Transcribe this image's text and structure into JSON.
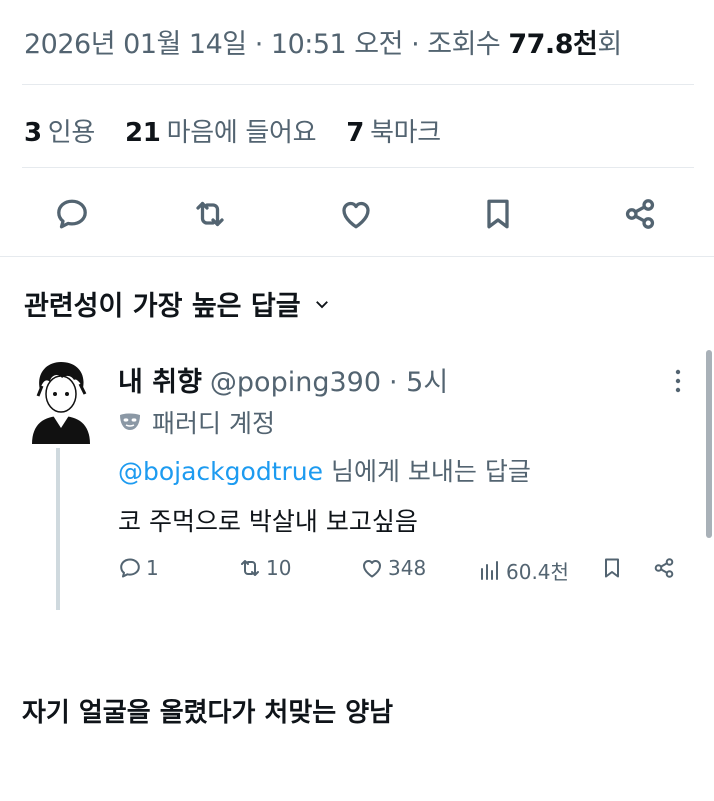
{
  "tweet_meta": {
    "date": "2026년 01월 14일",
    "time": "10:51 오전",
    "views_prefix": "조회수",
    "views_value": "77.8천",
    "views_suffix": "회"
  },
  "stats": {
    "quotes_count": "3",
    "quotes_label": "인용",
    "likes_count": "21",
    "likes_label": "마음에 들어요",
    "bookmarks_count": "7",
    "bookmarks_label": "북마크"
  },
  "action_icons": [
    "reply-icon",
    "retweet-icon",
    "like-icon",
    "bookmark-icon",
    "share-icon"
  ],
  "sort": {
    "label": "관련성이 가장 높은 답글"
  },
  "reply": {
    "name": "내 취향",
    "handle": "@poping390",
    "time": "· 5시",
    "parody_label": "패러디 계정",
    "reply_to_handle": "@bojackgodtrue",
    "reply_to_suffix": " 님에게 보내는 답글",
    "text": "코 주먹으로 박살내 보고싶음",
    "replies": "1",
    "retweets": "10",
    "likes": "348",
    "views": "60.4천"
  },
  "caption": "자기 얼굴을 올렸다가 처맞는 양남",
  "colors": {
    "text": "#0f1419",
    "muted": "#536471",
    "link": "#1d9bf0",
    "divider": "#e6eaee"
  }
}
